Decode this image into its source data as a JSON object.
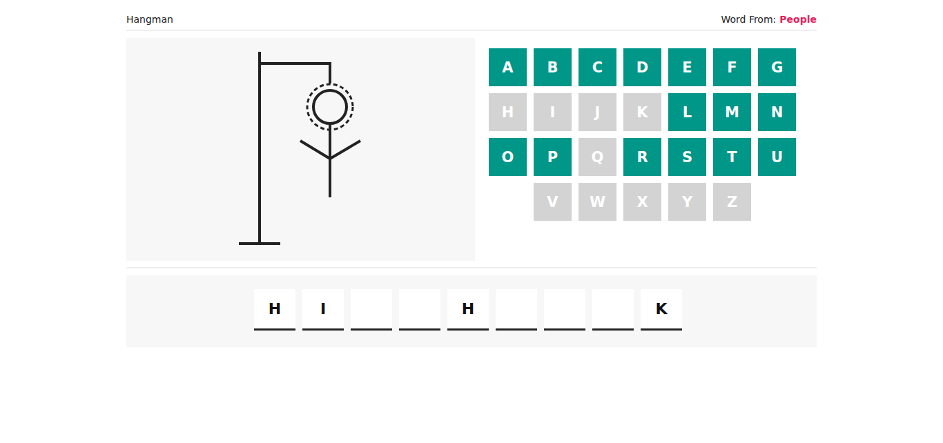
{
  "header": {
    "title": "Hangman",
    "category_label": "Word From:",
    "category": "People"
  },
  "figure": {
    "gallows": true,
    "head": true,
    "head_dashed_ring": true,
    "body": true,
    "left_arm": true,
    "right_arm": true,
    "left_leg": false,
    "right_leg": false
  },
  "keyboard": {
    "rows": [
      [
        {
          "letter": "A",
          "used": false
        },
        {
          "letter": "B",
          "used": false
        },
        {
          "letter": "C",
          "used": false
        },
        {
          "letter": "D",
          "used": false
        },
        {
          "letter": "E",
          "used": false
        },
        {
          "letter": "F",
          "used": false
        },
        {
          "letter": "G",
          "used": false
        }
      ],
      [
        {
          "letter": "H",
          "used": true
        },
        {
          "letter": "I",
          "used": true
        },
        {
          "letter": "J",
          "used": true
        },
        {
          "letter": "K",
          "used": true
        },
        {
          "letter": "L",
          "used": false
        },
        {
          "letter": "M",
          "used": false
        },
        {
          "letter": "N",
          "used": false
        }
      ],
      [
        {
          "letter": "O",
          "used": false
        },
        {
          "letter": "P",
          "used": false
        },
        {
          "letter": "Q",
          "used": true
        },
        {
          "letter": "R",
          "used": false
        },
        {
          "letter": "S",
          "used": false
        },
        {
          "letter": "T",
          "used": false
        },
        {
          "letter": "U",
          "used": false
        }
      ],
      [
        {
          "letter": "V",
          "used": true
        },
        {
          "letter": "W",
          "used": true
        },
        {
          "letter": "X",
          "used": true
        },
        {
          "letter": "Y",
          "used": true
        },
        {
          "letter": "Z",
          "used": true
        }
      ]
    ]
  },
  "word": [
    {
      "letter": "H"
    },
    {
      "letter": "I"
    },
    {
      "letter": ""
    },
    {
      "letter": ""
    },
    {
      "letter": "H"
    },
    {
      "letter": ""
    },
    {
      "letter": ""
    },
    {
      "letter": ""
    },
    {
      "letter": "K"
    }
  ]
}
